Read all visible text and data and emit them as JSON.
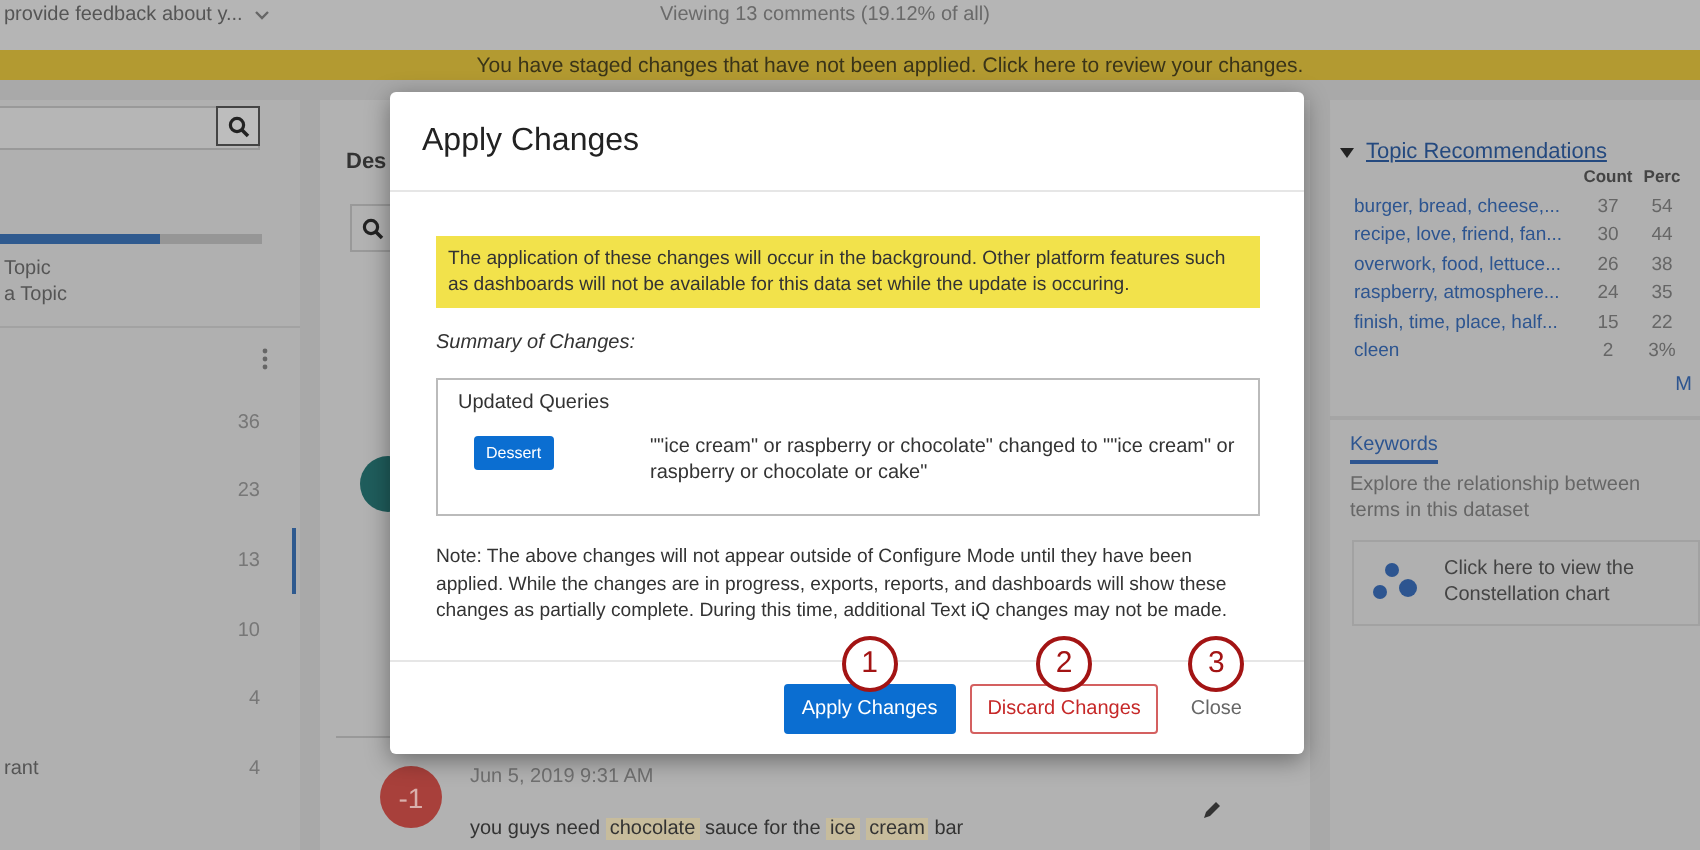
{
  "top_bar": {
    "survey_selector": "provide feedback about y...",
    "viewing": "Viewing 13 comments (19.12% of all)"
  },
  "banner": {
    "text": "You have staged changes that have not been applied. Click here to review your changes."
  },
  "left_panel": {
    "topic_progress": {
      "level": 0.61
    },
    "labels": [
      "Topic",
      "a Topic"
    ],
    "items": [
      {
        "count": "36",
        "selected": false
      },
      {
        "count": "23",
        "selected": false
      },
      {
        "count": "13",
        "selected": true
      },
      {
        "count": "10",
        "selected": false
      },
      {
        "count": "4",
        "selected": false
      },
      {
        "label": "rant",
        "count": "4",
        "selected": false
      }
    ]
  },
  "middle_panel": {
    "title": "Des",
    "comment": {
      "score": "-1",
      "date": "Jun 5, 2019 9:31 AM",
      "segments": [
        {
          "text": "you guys need",
          "highlighted": false
        },
        {
          "text": "chocolate",
          "highlighted": true
        },
        {
          "text": "sauce for the",
          "highlighted": false
        },
        {
          "text": "ice",
          "highlighted": true
        },
        {
          "text": "cream",
          "highlighted": true
        },
        {
          "text": "bar",
          "highlighted": false
        }
      ]
    }
  },
  "right_panel": {
    "topic_recommendations": {
      "title": "Topic Recommendations",
      "columns": [
        "Count",
        "Perc"
      ],
      "rows": [
        {
          "topic": "burger, bread, cheese,...",
          "count": "37",
          "percent": "54"
        },
        {
          "topic": "recipe, love, friend, fan...",
          "count": "30",
          "percent": "44"
        },
        {
          "topic": "overwork, food, lettuce...",
          "count": "26",
          "percent": "38"
        },
        {
          "topic": "raspberry, atmosphere...",
          "count": "24",
          "percent": "35"
        },
        {
          "topic": "finish, time, place, half...",
          "count": "15",
          "percent": "22"
        },
        {
          "topic": "cleen",
          "count": "2",
          "percent": "3%"
        }
      ],
      "more": "M"
    },
    "keywords": {
      "tab": "Keywords",
      "description": "Explore the relationship between terms in this dataset",
      "card": "Click here to view the Constellation chart"
    }
  },
  "modal": {
    "title": "Apply Changes",
    "notice": "The application of these changes will occur in the background. Other platform features such as dashboards will not be available for this data set while the update is occuring.",
    "summary_label": "Summary of Changes:",
    "box_title": "Updated Queries",
    "changes": [
      {
        "tag": "Dessert",
        "description": "\"\"ice cream\" or raspberry or chocolate\" changed to \"\"ice cream\" or raspberry or chocolate or cake\""
      }
    ],
    "note": "Note: The above changes will not appear outside of Configure Mode until they have been applied. While the changes are in progress, exports, reports, and dashboards will show these changes as partially complete. During this time, additional Text iQ changes may not be made.",
    "buttons": [
      {
        "kind": "primary",
        "label": "Apply Changes",
        "callout": "1"
      },
      {
        "kind": "danger",
        "label": "Discard Changes",
        "callout": "2"
      },
      {
        "kind": "link",
        "label": "Close",
        "callout": "3"
      }
    ]
  }
}
